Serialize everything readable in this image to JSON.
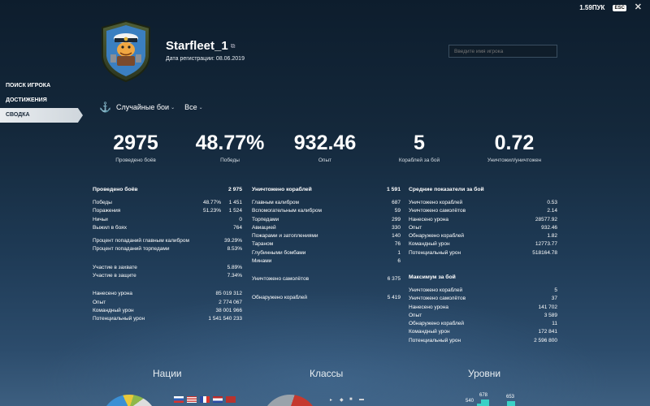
{
  "topbar": {
    "version": "1.59ПУК",
    "esc": "ESC",
    "close": "✕"
  },
  "profile": {
    "name": "Starfleet_1",
    "reg_label": "Дата регистрации:",
    "reg_date": "08.06.2019"
  },
  "search": {
    "placeholder": "Введите имя игрока"
  },
  "sidebar": {
    "items": [
      {
        "label": "ПОИСК ИГРОКА"
      },
      {
        "label": "ДОСТИЖЕНИЯ"
      },
      {
        "label": "СВОДКА"
      }
    ]
  },
  "filters": {
    "mode": "Случайные бои",
    "scope": "Все"
  },
  "summary": [
    {
      "value": "2975",
      "label": "Проведено боёв"
    },
    {
      "value": "48.77%",
      "label": "Победы"
    },
    {
      "value": "932.46",
      "label": "Опыт"
    },
    {
      "value": "5",
      "label": "Кораблей за бой"
    },
    {
      "value": "0.72",
      "label": "Уничтожил/уничтожен"
    }
  ],
  "battles": {
    "header": {
      "label": "Проведено боёв",
      "value": "2 975"
    },
    "rows": [
      {
        "label": "Победы",
        "pct": "48.77%",
        "num": "1 451"
      },
      {
        "label": "Поражения",
        "pct": "51.23%",
        "num": "1 524"
      },
      {
        "label": "Ничьи",
        "num": "0"
      },
      {
        "label": "Выжил в боях",
        "num": "764"
      },
      {
        "label": "Процент попаданий главным калибром",
        "num": "39.29%"
      },
      {
        "label": "Процент попаданий торпедами",
        "num": "8.53%"
      },
      {
        "label": "Участие в захвате",
        "num": "5.89%"
      },
      {
        "label": "Участие в защите",
        "num": "7.34%"
      },
      {
        "label": "Нанесено урона",
        "num": "85 019 312"
      },
      {
        "label": "Опыт",
        "num": "2 774 067"
      },
      {
        "label": "Командный урон",
        "num": "38 001 966"
      },
      {
        "label": "Потенциальный урон",
        "num": "1 541 540 233"
      }
    ]
  },
  "destroyed": {
    "header": {
      "label": "Уничтожено кораблей",
      "value": "1 591"
    },
    "rows": [
      {
        "label": "Главным калибром",
        "num": "687"
      },
      {
        "label": "Вспомогательным калибром",
        "num": "59"
      },
      {
        "label": "Торпедами",
        "num": "299"
      },
      {
        "label": "Авиацией",
        "num": "330"
      },
      {
        "label": "Пожарами и затоплениями",
        "num": "140"
      },
      {
        "label": "Тараном",
        "num": "76"
      },
      {
        "label": "Глубинными бомбами",
        "num": "1"
      },
      {
        "label": "Минами",
        "num": "6"
      },
      {
        "label": "Уничтожено самолётов",
        "num": "6 375"
      },
      {
        "label": "Обнаружено кораблей",
        "num": "5 419"
      }
    ]
  },
  "averages": {
    "header": "Средние показатели за бой",
    "rows": [
      {
        "label": "Уничтожено кораблей",
        "num": "0.53"
      },
      {
        "label": "Уничтожено самолётов",
        "num": "2.14"
      },
      {
        "label": "Нанесено урона",
        "num": "28577.92"
      },
      {
        "label": "Опыт",
        "num": "932.46"
      },
      {
        "label": "Обнаружено кораблей",
        "num": "1.82"
      },
      {
        "label": "Командный урон",
        "num": "12773.77"
      },
      {
        "label": "Потенциальный урон",
        "num": "518164.78"
      }
    ]
  },
  "maximum": {
    "header": "Максимум за бой",
    "rows": [
      {
        "label": "Уничтожено кораблей",
        "num": "5"
      },
      {
        "label": "Уничтожено самолётов",
        "num": "37"
      },
      {
        "label": "Нанесено урона",
        "num": "141 702"
      },
      {
        "label": "Опыт",
        "num": "3 589"
      },
      {
        "label": "Обнаружено кораблей",
        "num": "11"
      },
      {
        "label": "Командный урон",
        "num": "172 841"
      },
      {
        "label": "Потенциальный урон",
        "num": "2 596 800"
      }
    ]
  },
  "sections": {
    "nations": "Нации",
    "classes": "Классы",
    "tiers": "Уровни"
  },
  "tiers_partial": [
    {
      "label": "540"
    },
    {
      "label": "678"
    },
    {
      "label": "653"
    }
  ],
  "colors": {
    "accent": "#3ad1c6",
    "active_tab_bg": "#e9edf0",
    "panel_bg": "#14283b"
  }
}
